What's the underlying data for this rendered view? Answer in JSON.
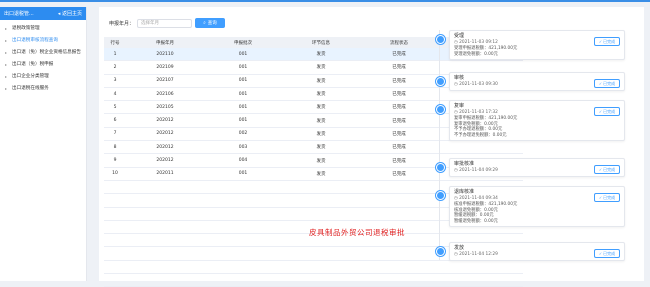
{
  "sidebar": {
    "title": "出口退税管...",
    "back": "返回主页",
    "items": [
      {
        "label": "退税政策管理"
      },
      {
        "label": "出口退税审核流程查询"
      },
      {
        "label": "出口退（免）税企业资格信息报告"
      },
      {
        "label": "出口退（免）税申报"
      },
      {
        "label": "出口企业分类管理"
      },
      {
        "label": "出口退税在线服务"
      }
    ]
  },
  "filter": {
    "label": "申报年月：",
    "placeholder": "选择年月",
    "button": "查询"
  },
  "table": {
    "headers": [
      "行号",
      "申报年月",
      "申报批次",
      "环节信息",
      "流程状态"
    ],
    "rows": [
      [
        "1",
        "202110",
        "001",
        "发货",
        "已完成"
      ],
      [
        "2",
        "202109",
        "001",
        "发货",
        "已完成"
      ],
      [
        "3",
        "202107",
        "001",
        "发货",
        "已完成"
      ],
      [
        "4",
        "202106",
        "001",
        "发货",
        "已完成"
      ],
      [
        "5",
        "202105",
        "001",
        "发货",
        "已完成"
      ],
      [
        "6",
        "202012",
        "001",
        "发货",
        "已完成"
      ],
      [
        "7",
        "202012",
        "002",
        "发货",
        "已完成"
      ],
      [
        "8",
        "202012",
        "003",
        "发货",
        "已完成"
      ],
      [
        "9",
        "202012",
        "004",
        "发货",
        "已完成"
      ],
      [
        "10",
        "202011",
        "001",
        "发货",
        "已完成"
      ]
    ]
  },
  "watermark": "皮具制品外贸公司退税审批",
  "timeline": [
    {
      "title": "受理",
      "time": "2021-11-03 09:12",
      "lines": [
        "受理申报退税额：421,190.00元",
        "受理退免税额：0.00元"
      ],
      "status": "已完成"
    },
    {
      "title": "审核",
      "time": "2021-11-03 09:30",
      "lines": [],
      "status": "已完成"
    },
    {
      "title": "复审",
      "time": "2021-11-03 17:32",
      "lines": [
        "复审申报退税额：421,190.00元",
        "复审退免税额：0.00元",
        "不予办理退税额：0.00元",
        "不予办理退免税额：0.00元"
      ],
      "status": "已完成"
    },
    {
      "title": "审批核准",
      "time": "2021-11-04 09:29",
      "lines": [],
      "status": "已完成"
    },
    {
      "title": "退库核准",
      "time": "2021-11-04 09:34",
      "lines": [
        "核准申报退税额：421,190.00元",
        "核准退免税额：0.00元",
        "暂缓退税额：0.00元",
        "暂缓退免税额：0.00元"
      ],
      "status": "已完成"
    },
    {
      "title": "发放",
      "time": "2021-11-04 12:29",
      "lines": [],
      "status": "已完成"
    }
  ]
}
